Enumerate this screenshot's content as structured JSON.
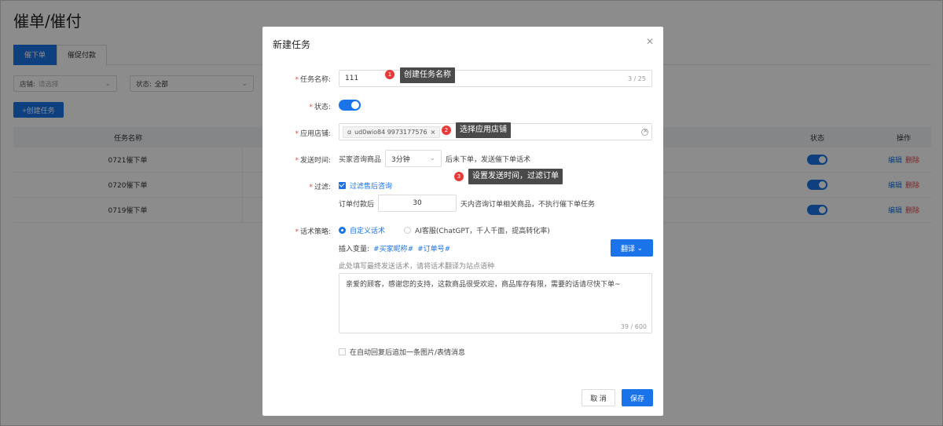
{
  "page": {
    "title": "催单/催付",
    "tabs": [
      {
        "label": "催下单"
      },
      {
        "label": "催促付款"
      }
    ],
    "filters": {
      "store_label": "店铺:",
      "store_placeholder": "请选择",
      "status_label": "状态:",
      "status_value": "全部"
    },
    "create_button": "+创建任务",
    "table": {
      "headers": {
        "name": "任务名称",
        "status": "状态",
        "ops": "操作"
      },
      "rows": [
        {
          "name": "0721催下单",
          "enabled": true,
          "edit": "编辑",
          "delete": "删除"
        },
        {
          "name": "0720催下单",
          "enabled": true,
          "edit": "编辑",
          "delete": "删除"
        },
        {
          "name": "0719催下单",
          "enabled": true,
          "edit": "编辑",
          "delete": "删除"
        }
      ]
    }
  },
  "modal": {
    "title": "新建任务",
    "close_icon": "close-icon",
    "task_name": {
      "label": "任务名称:",
      "value": "111",
      "counter": "3 / 25"
    },
    "status": {
      "label": "状态:",
      "enabled": true
    },
    "store": {
      "label": "应用店铺:",
      "tag": "ud0wio84 9973177576",
      "tag_prefix": "ɑ"
    },
    "send_time": {
      "label": "发送时间:",
      "prefix": "买家咨询商品",
      "select_value": "3分钟",
      "suffix": "后未下单，发送催下单话术"
    },
    "filter": {
      "label": "过滤:",
      "checkbox_label": "过滤售后咨询",
      "checked": true,
      "prefix": "订单付款后",
      "days_value": "30",
      "suffix": "天内咨询订单相关商品，不执行催下单任务"
    },
    "strategy": {
      "label": "话术策略:",
      "options": [
        {
          "label": "自定义话术",
          "selected": true
        },
        {
          "label": "AI客服(ChatGPT，千人千面，提高转化率)",
          "selected": false
        }
      ],
      "insert_label": "插入变量:",
      "variables": [
        "#买家昵称#",
        "#订单号#"
      ],
      "translate_button": "翻译",
      "hint": "此处填写最终发送话术，请将话术翻译为站点语种",
      "message": "亲爱的顾客，感谢您的支持，这款商品很受欢迎，商品库存有限，需要的话请尽快下单~",
      "counter": "39 / 600",
      "append_label": "在自动回复后追加一条图片/表情消息",
      "append_checked": false
    },
    "cancel_button": "取 消",
    "save_button": "保存"
  },
  "annotations": [
    {
      "num": "1",
      "text": "创建任务名称"
    },
    {
      "num": "2",
      "text": "选择应用店铺"
    },
    {
      "num": "3",
      "text": "设置发送时间，过滤订单"
    }
  ]
}
